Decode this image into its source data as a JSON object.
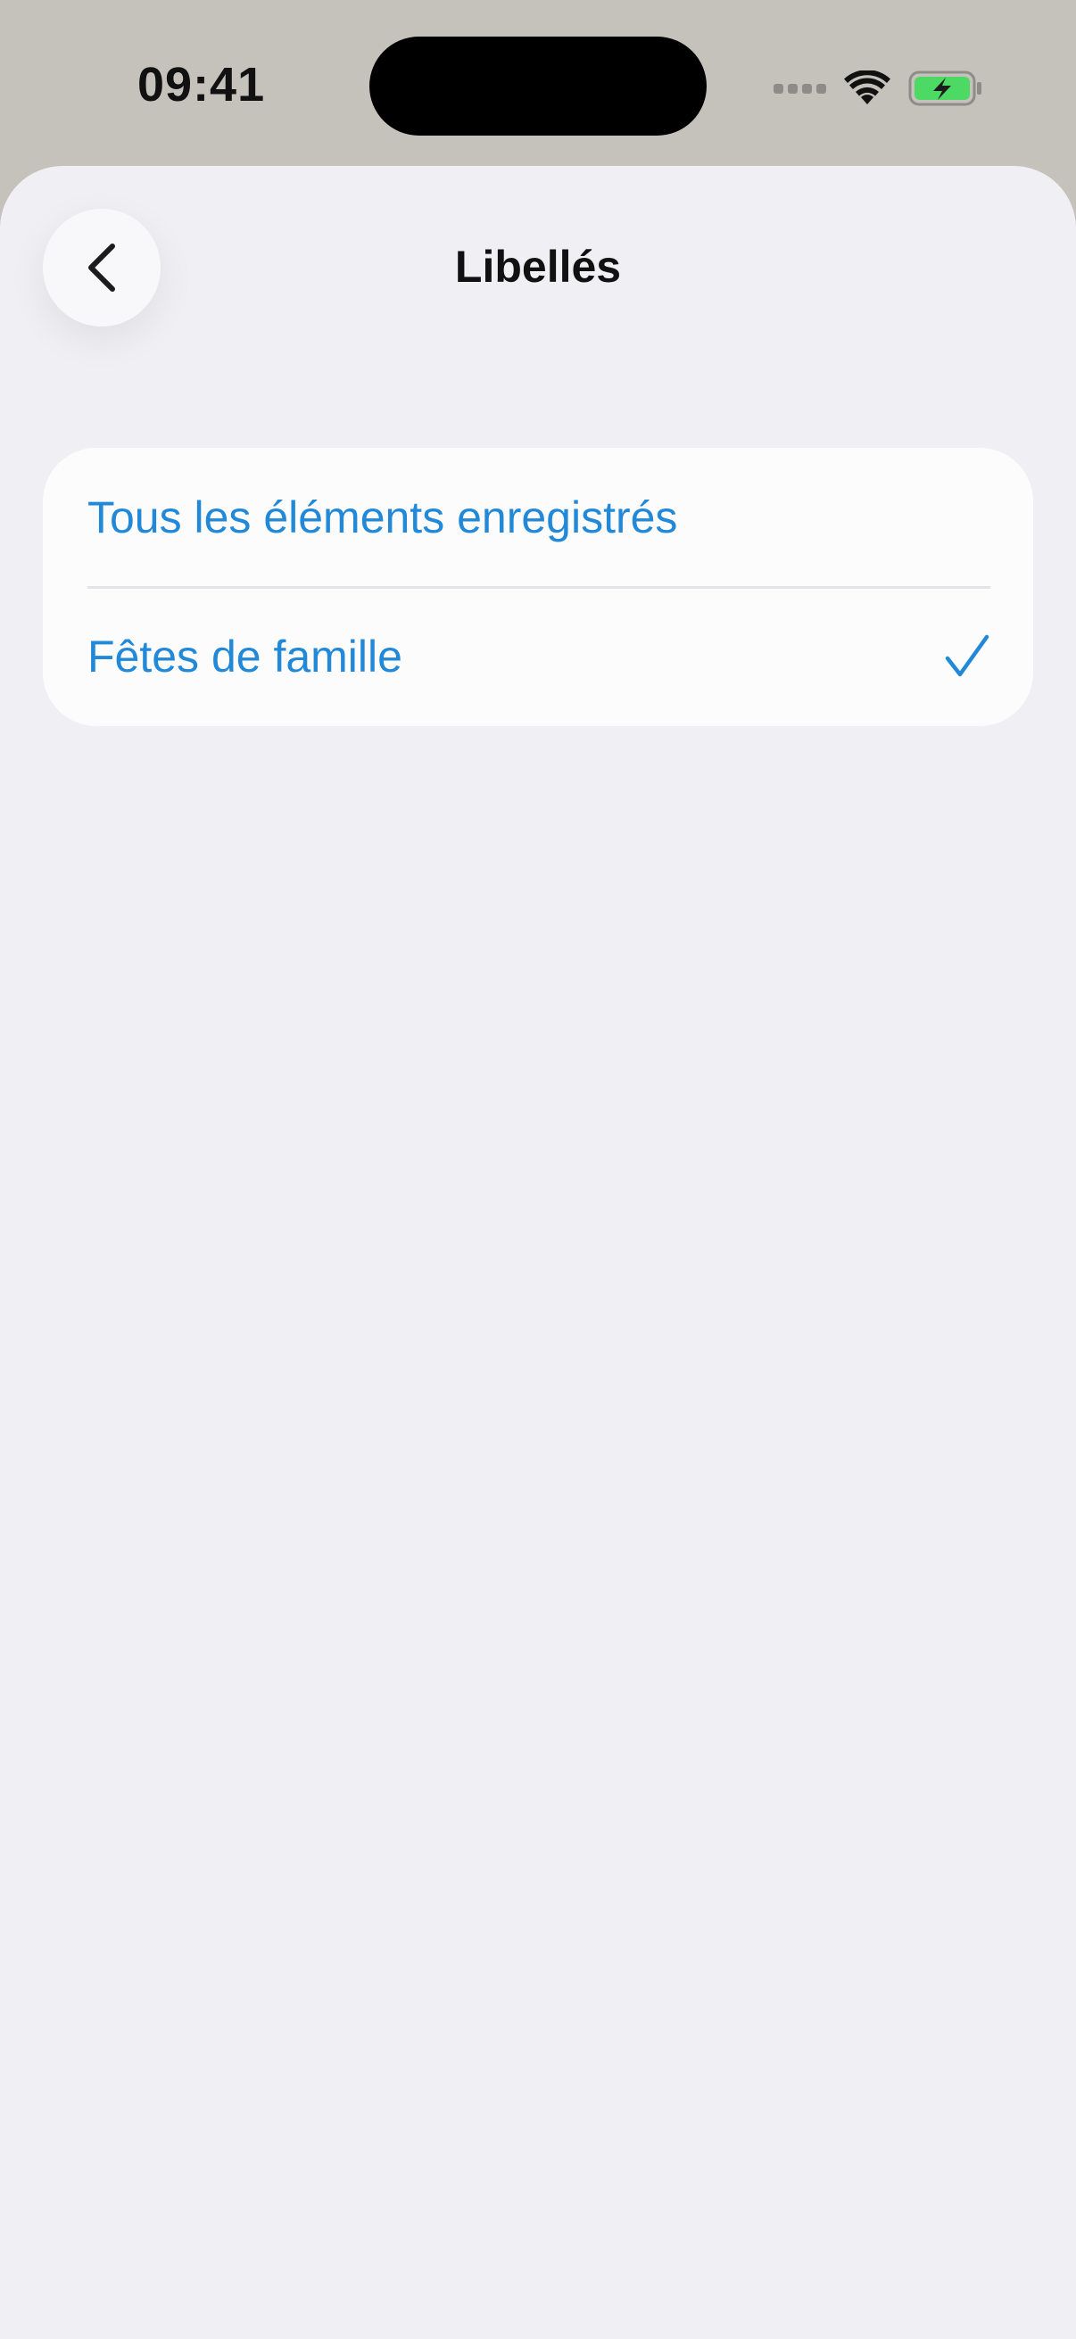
{
  "status_bar": {
    "time": "09:41",
    "icons": [
      "cellular-signal-icon",
      "wifi-icon",
      "battery-charging-icon"
    ]
  },
  "header": {
    "title": "Libellés",
    "back_icon": "chevron-left-icon"
  },
  "list": {
    "items": [
      {
        "label": "Tous les éléments enregistrés",
        "selected": false
      },
      {
        "label": "Fêtes de famille",
        "selected": true
      }
    ]
  },
  "colors": {
    "accent": "#2189d8",
    "background": "#f0f0f4",
    "card": "#fcfcfd",
    "status_bar_bg": "#c5c2bb",
    "battery": "#4cd964"
  }
}
